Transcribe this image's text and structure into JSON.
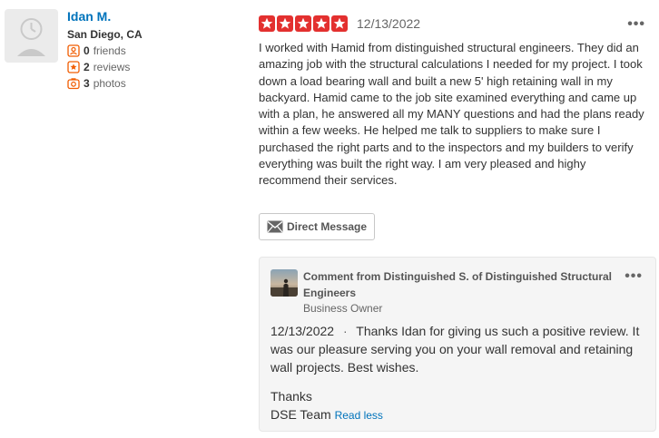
{
  "user": {
    "name": "Idan M.",
    "location": "San Diego, CA",
    "friends_count": "0",
    "friends_label": "friends",
    "reviews_count": "2",
    "reviews_label": "reviews",
    "photos_count": "3",
    "photos_label": "photos"
  },
  "review": {
    "rating": 5,
    "date": "12/13/2022",
    "text": "I worked with Hamid from distinguished structural engineers. They did an amazing job with the structural calculations I needed for my project. I took down a load bearing wall and built a new 5' high retaining wall in my backyard. Hamid came to the job site examined everything and came up with a plan, he answered all my MANY questions and had the plans ready within a few weeks. He helped me talk to suppliers to make sure I purchased the right parts and to the inspectors and my builders to verify everything was built the right way. I am very pleased and highy recommend their services.",
    "more_icon": "more-dots-icon"
  },
  "direct_message": {
    "label": "Direct Message",
    "icon": "mail-icon"
  },
  "owner_comment": {
    "title": "Comment from Distinguished S. of Distinguished Structural Engineers",
    "role": "Business Owner",
    "date": "12/13/2022",
    "separator": "·",
    "text": "Thanks Idan for giving us such a positive review. It was our pleasure serving you on your wall removal and retaining wall projects. Best wishes.",
    "signoff_line1": "Thanks",
    "signoff_line2": "DSE Team",
    "read_less": "Read less"
  },
  "colors": {
    "star_red": "#e3302f",
    "link_blue": "#0073bb",
    "stat_orange": "#f15c00"
  }
}
